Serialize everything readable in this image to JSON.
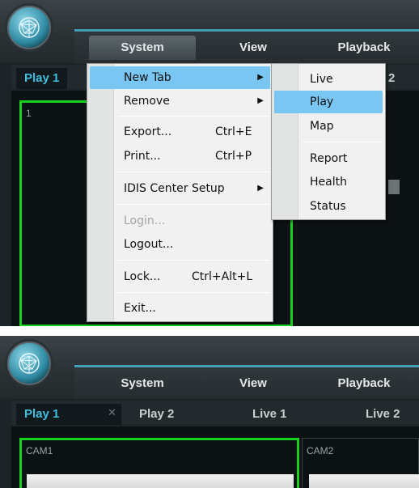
{
  "top": {
    "menus": [
      "System",
      "View",
      "Playback"
    ],
    "tabs": {
      "active": "Play 1",
      "partial_right": "2"
    },
    "cell_number": "1",
    "system_menu": [
      {
        "label": "New Tab",
        "shortcut": "",
        "submenu": true,
        "highlighted": true
      },
      {
        "label": "Remove",
        "shortcut": "",
        "submenu": true
      },
      {
        "label": "Export...",
        "shortcut": "Ctrl+E"
      },
      {
        "label": "Print...",
        "shortcut": "Ctrl+P"
      },
      {
        "label": "IDIS Center Setup",
        "shortcut": "",
        "submenu": true
      },
      {
        "label": "Login...",
        "shortcut": "",
        "disabled": true
      },
      {
        "label": "Logout...",
        "shortcut": ""
      },
      {
        "label": "Lock...",
        "shortcut": "Ctrl+Alt+L"
      },
      {
        "label": "Exit...",
        "shortcut": ""
      }
    ],
    "new_tab_submenu": [
      "Live",
      "Play",
      "Map",
      "Report",
      "Health",
      "Status"
    ],
    "new_tab_submenu_highlighted": "Play"
  },
  "bottom": {
    "menus": [
      "System",
      "View",
      "Playback"
    ],
    "tabs": [
      "Play 1",
      "Play 2",
      "Live 1",
      "Live 2"
    ],
    "close_glyph": "✕",
    "cameras": [
      "CAM1",
      "CAM2"
    ]
  },
  "colors": {
    "accent_teal": "#3fa0b5",
    "active_tab_text": "#3fbfe0",
    "selected_cell_border": "#17d11d",
    "menu_highlight": "#79c6f2"
  },
  "icons": {
    "logo": "idis-globe-logo-icon",
    "submenu_arrow": "triangle-right-icon",
    "close": "close-icon"
  }
}
